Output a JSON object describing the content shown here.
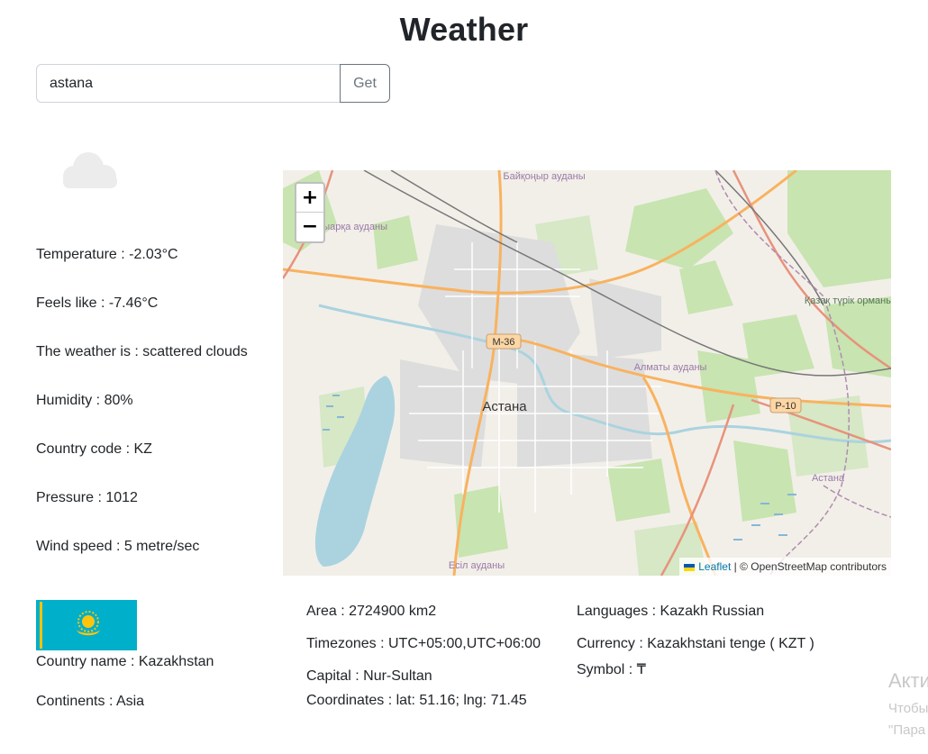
{
  "header": {
    "title": "Weather"
  },
  "search": {
    "value": "astana",
    "button_label": "Get"
  },
  "weather": {
    "icon": "cloud-icon",
    "temperature": "Temperature : -2.03°C",
    "feels_like": "Feels like : -7.46°C",
    "description": "The weather is : scattered clouds",
    "humidity": "Humidity : 80%",
    "country_code": "Country code : KZ",
    "pressure": "Pressure : 1012",
    "wind_speed": "Wind speed : 5 metre/sec"
  },
  "map": {
    "zoom_in": "+",
    "zoom_out": "−",
    "city_label": "Астана",
    "district_labels": [
      "Сарыарқа ауданы",
      "Алматы ауданы",
      "Есіл ауданы",
      "Байқоңыр ауданы",
      "Қазақ түрік орманы",
      "Астана"
    ],
    "road_labels": [
      "M-36",
      "P-10"
    ],
    "attribution_link": "Leaflet",
    "attribution_text": "| © OpenStreetMap contributors"
  },
  "country": {
    "flag_colors": {
      "background": "#00afca",
      "emblem": "#fec50c"
    },
    "name": "Country name : Kazakhstan",
    "continents": "Continents : Asia",
    "area": "Area : 2724900 km2",
    "timezones": "Timezones : UTC+05:00,UTC+06:00",
    "capital": "Capital : Nur-Sultan",
    "coordinates": "Coordinates : lat: 51.16; lng: 71.45",
    "languages": "Languages : Kazakh Russian",
    "currency": "Currency : Kazakhstani tenge ( KZT )",
    "symbol": "Symbol : ₸"
  },
  "watermark": {
    "line1": "Акти",
    "line2": "Чтобы",
    "line3": "\"Пара"
  }
}
